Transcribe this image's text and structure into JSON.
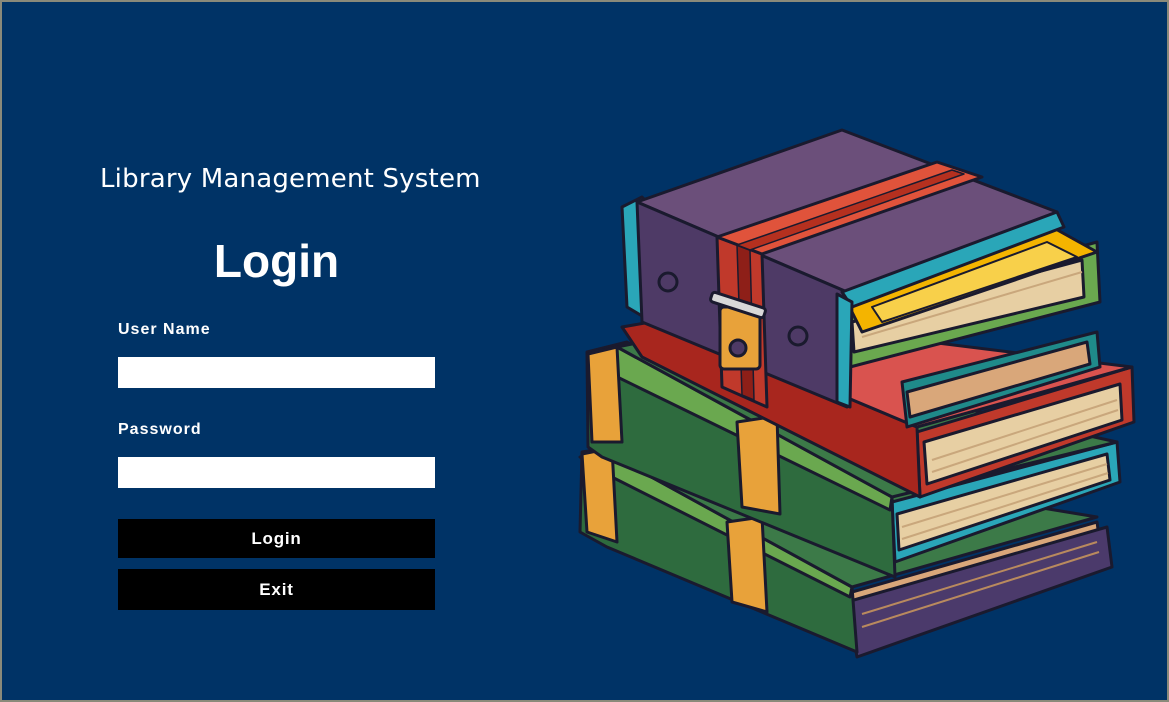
{
  "app": {
    "title": "Library Management System"
  },
  "login_form": {
    "heading": "Login",
    "username_label": "User Name",
    "username_value": "",
    "password_label": "Password",
    "password_value": "",
    "login_button_label": "Login",
    "exit_button_label": "Exit"
  },
  "colors": {
    "background": "#003366",
    "input_background": "#ffffff",
    "button_background": "#000000",
    "text": "#ffffff"
  },
  "illustration": {
    "icon": "stack-of-books-icon"
  }
}
